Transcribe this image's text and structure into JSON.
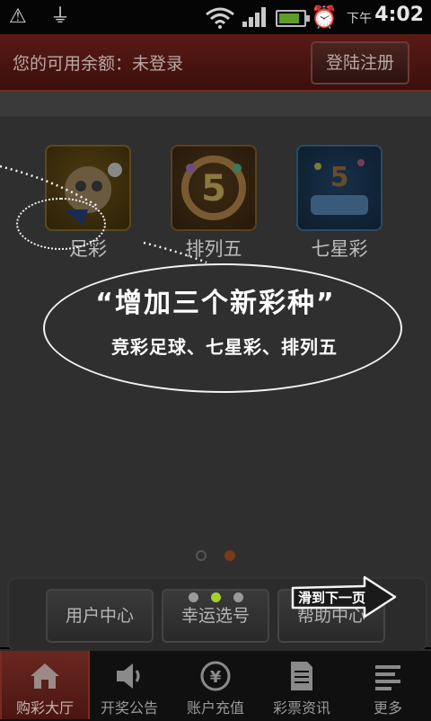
{
  "status_bar": {
    "time": "4:02",
    "ampm": "下午",
    "icons": [
      "warning-icon",
      "usb-icon",
      "wifi-icon",
      "signal-icon",
      "battery-icon",
      "alarm-icon"
    ]
  },
  "header": {
    "balance_text": "您的可用余额：未登录",
    "login_label": "登陆注册"
  },
  "games": [
    {
      "label": "足彩",
      "icon": "zucai-icon"
    },
    {
      "label": "排列五",
      "icon": "pailie5-icon"
    },
    {
      "label": "七星彩",
      "icon": "qixingcai-icon"
    }
  ],
  "overlay": {
    "title": "“增加三个新彩种”",
    "subtitle": "竞彩足球、七星彩、排列五",
    "next_label": "滑到下一页"
  },
  "bottom_buttons": [
    {
      "label": "用户中心"
    },
    {
      "label": "幸运选号"
    },
    {
      "label": "帮助中心"
    }
  ],
  "tabs": [
    {
      "label": "购彩大厅",
      "icon": "home-icon",
      "active": true
    },
    {
      "label": "开奖公告",
      "icon": "speaker-icon",
      "active": false
    },
    {
      "label": "账户充值",
      "icon": "yen-icon",
      "active": false
    },
    {
      "label": "彩票资讯",
      "icon": "document-icon",
      "active": false
    },
    {
      "label": "更多",
      "icon": "more-icon",
      "active": false
    }
  ],
  "colors": {
    "header_bg": "#4a1612",
    "highlight_dot": "#a3d02a",
    "page_indicator_active": "#7a3a1a"
  }
}
